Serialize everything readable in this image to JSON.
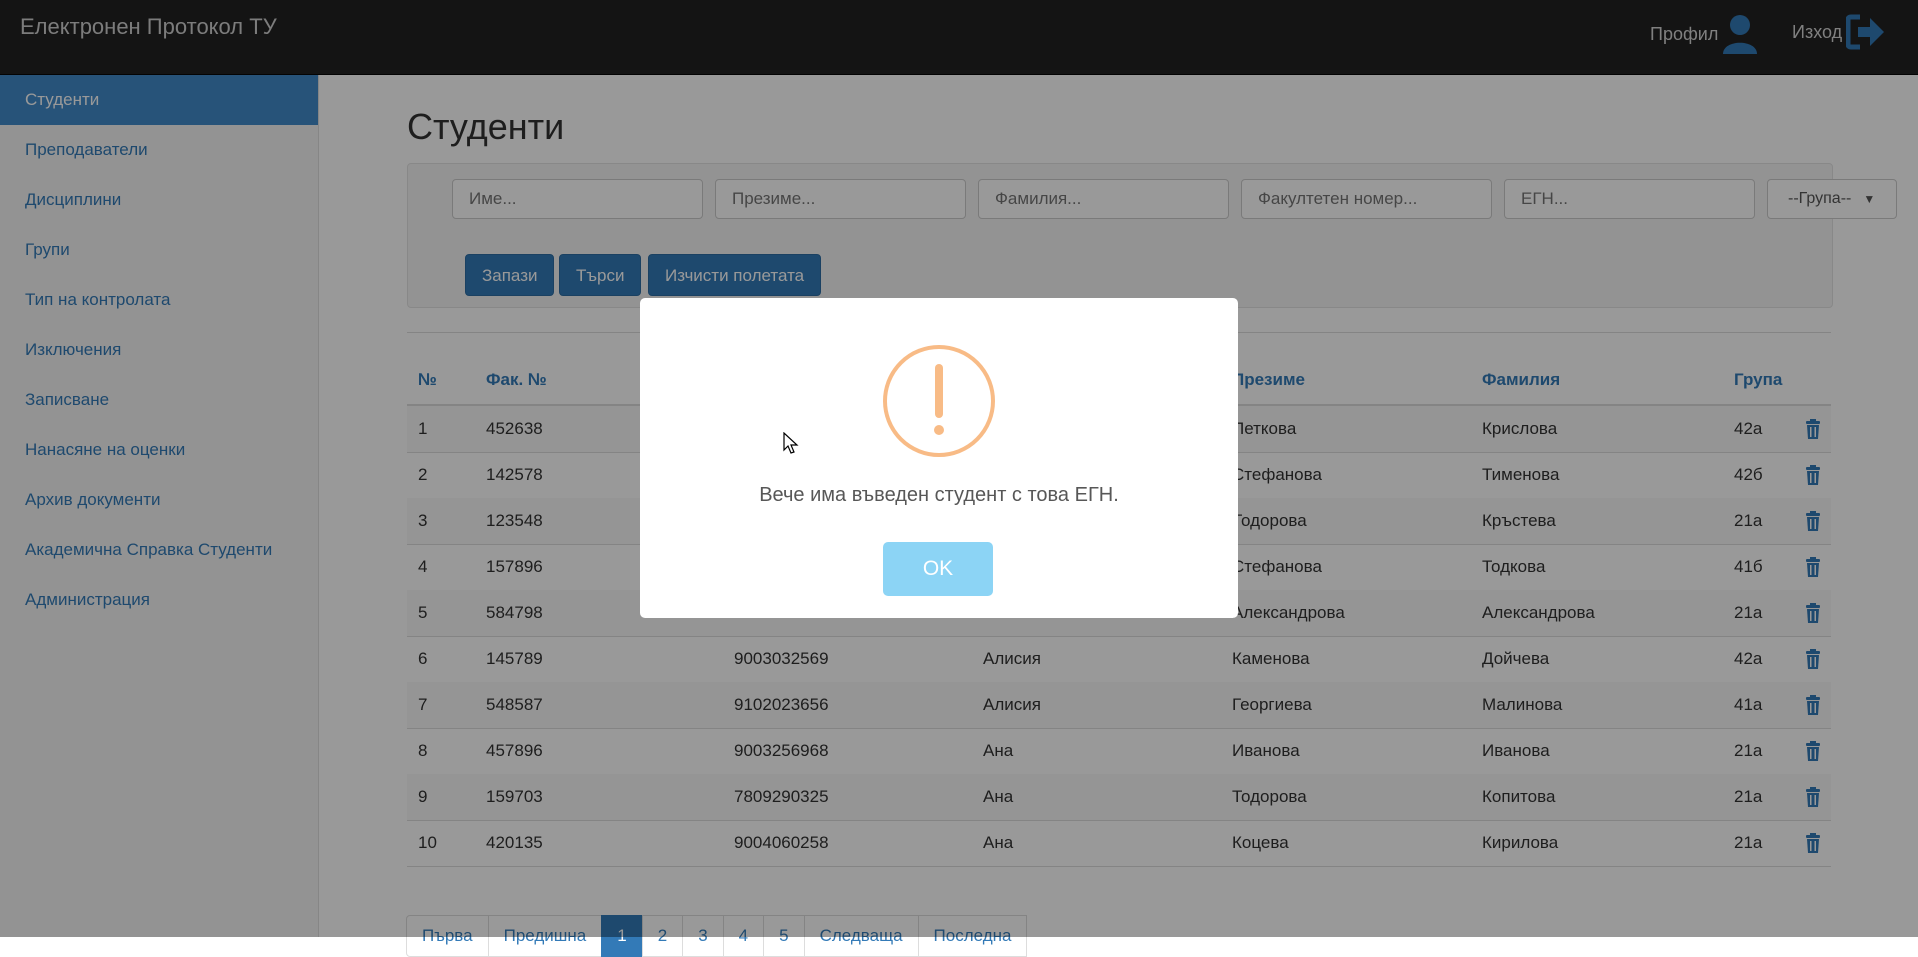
{
  "navbar": {
    "brand": "Електронен Протокол ТУ",
    "profile_label": "Профил",
    "exit_label": "Изход"
  },
  "sidebar": {
    "items": [
      {
        "label": "Студенти",
        "active": true
      },
      {
        "label": "Преподаватели"
      },
      {
        "label": "Дисциплини"
      },
      {
        "label": "Групи"
      },
      {
        "label": "Тип на контролата"
      },
      {
        "label": "Изключения"
      },
      {
        "label": "Записване"
      },
      {
        "label": "Нанасяне на оценки"
      },
      {
        "label": "Архив документи"
      },
      {
        "label": "Академична Справка Студенти"
      },
      {
        "label": "Администрация"
      }
    ]
  },
  "main": {
    "title": "Студенти",
    "filters": {
      "name_placeholder": "Име...",
      "middle_placeholder": "Презиме...",
      "last_placeholder": "Фамилия...",
      "facnum_placeholder": "Факултетен номер...",
      "egn_placeholder": "ЕГН...",
      "group_select": "--Група--"
    },
    "buttons": {
      "save": "Запази",
      "search": "Търси",
      "clear": "Изчисти полетата"
    },
    "table": {
      "headers": {
        "num": "№",
        "facnum": "Фак. №",
        "middle": "Презиме",
        "last": "Фамилия",
        "group": "Група"
      },
      "rows": [
        [
          "1",
          "452638",
          "",
          "",
          "Петкова",
          "Крислова",
          "42а"
        ],
        [
          "2",
          "142578",
          "",
          "",
          "Стефанова",
          "Тименова",
          "42б"
        ],
        [
          "3",
          "123548",
          "",
          "",
          "Тодорова",
          "Кръстева",
          "21а"
        ],
        [
          "4",
          "157896",
          "",
          "",
          "Стефанова",
          "Тодкова",
          "41б"
        ],
        [
          "5",
          "584798",
          "",
          "",
          "Александрова",
          "Александрова",
          "21а"
        ],
        [
          "6",
          "145789",
          "9003032569",
          "Алисия",
          "Каменова",
          "Дойчева",
          "42а"
        ],
        [
          "7",
          "548587",
          "9102023656",
          "Алисия",
          "Георгиева",
          "Малинова",
          "41а"
        ],
        [
          "8",
          "457896",
          "9003256968",
          "Ана",
          "Иванова",
          "Иванова",
          "21а"
        ],
        [
          "9",
          "159703",
          "7809290325",
          "Ана",
          "Тодорова",
          "Копитова",
          "21а"
        ],
        [
          "10",
          "420135",
          "9004060258",
          "Ана",
          "Коцева",
          "Кирилова",
          "21а"
        ]
      ]
    },
    "pagination": [
      "Първа",
      "Предишна",
      "1",
      "2",
      "3",
      "4",
      "5",
      "Следваща",
      "Последна"
    ]
  },
  "dialog": {
    "message": "Вече има въведен студент с това ЕГН.",
    "ok_label": "OK"
  },
  "colors": {
    "primary": "#337ab7",
    "warning": "#f8bb86",
    "ok_button": "#8cd4f5"
  }
}
